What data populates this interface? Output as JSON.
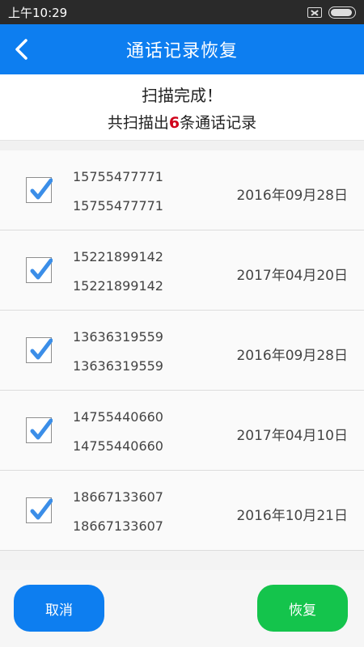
{
  "status": {
    "time": "上午10:29"
  },
  "header": {
    "title": "通话记录恢复"
  },
  "summary": {
    "title": "扫描完成！",
    "prefix": "共扫描出",
    "count": "6",
    "suffix": "条通话记录"
  },
  "records": [
    {
      "number": "15755477771",
      "number_repeat": "15755477771",
      "date": "2016年09月28日",
      "checked": true
    },
    {
      "number": "15221899142",
      "number_repeat": "15221899142",
      "date": "2017年04月20日",
      "checked": true
    },
    {
      "number": "13636319559",
      "number_repeat": "13636319559",
      "date": "2016年09月28日",
      "checked": true
    },
    {
      "number": "14755440660",
      "number_repeat": "14755440660",
      "date": "2017年04月10日",
      "checked": true
    },
    {
      "number": "18667133607",
      "number_repeat": "18667133607",
      "date": "2016年10月21日",
      "checked": true
    }
  ],
  "footer": {
    "cancel_label": "取消",
    "restore_label": "恢复"
  },
  "colors": {
    "accent_blue": "#0d7ef0",
    "restore_green": "#14c44c",
    "count_red": "#d0021b",
    "check_blue": "#3b8ee8"
  }
}
